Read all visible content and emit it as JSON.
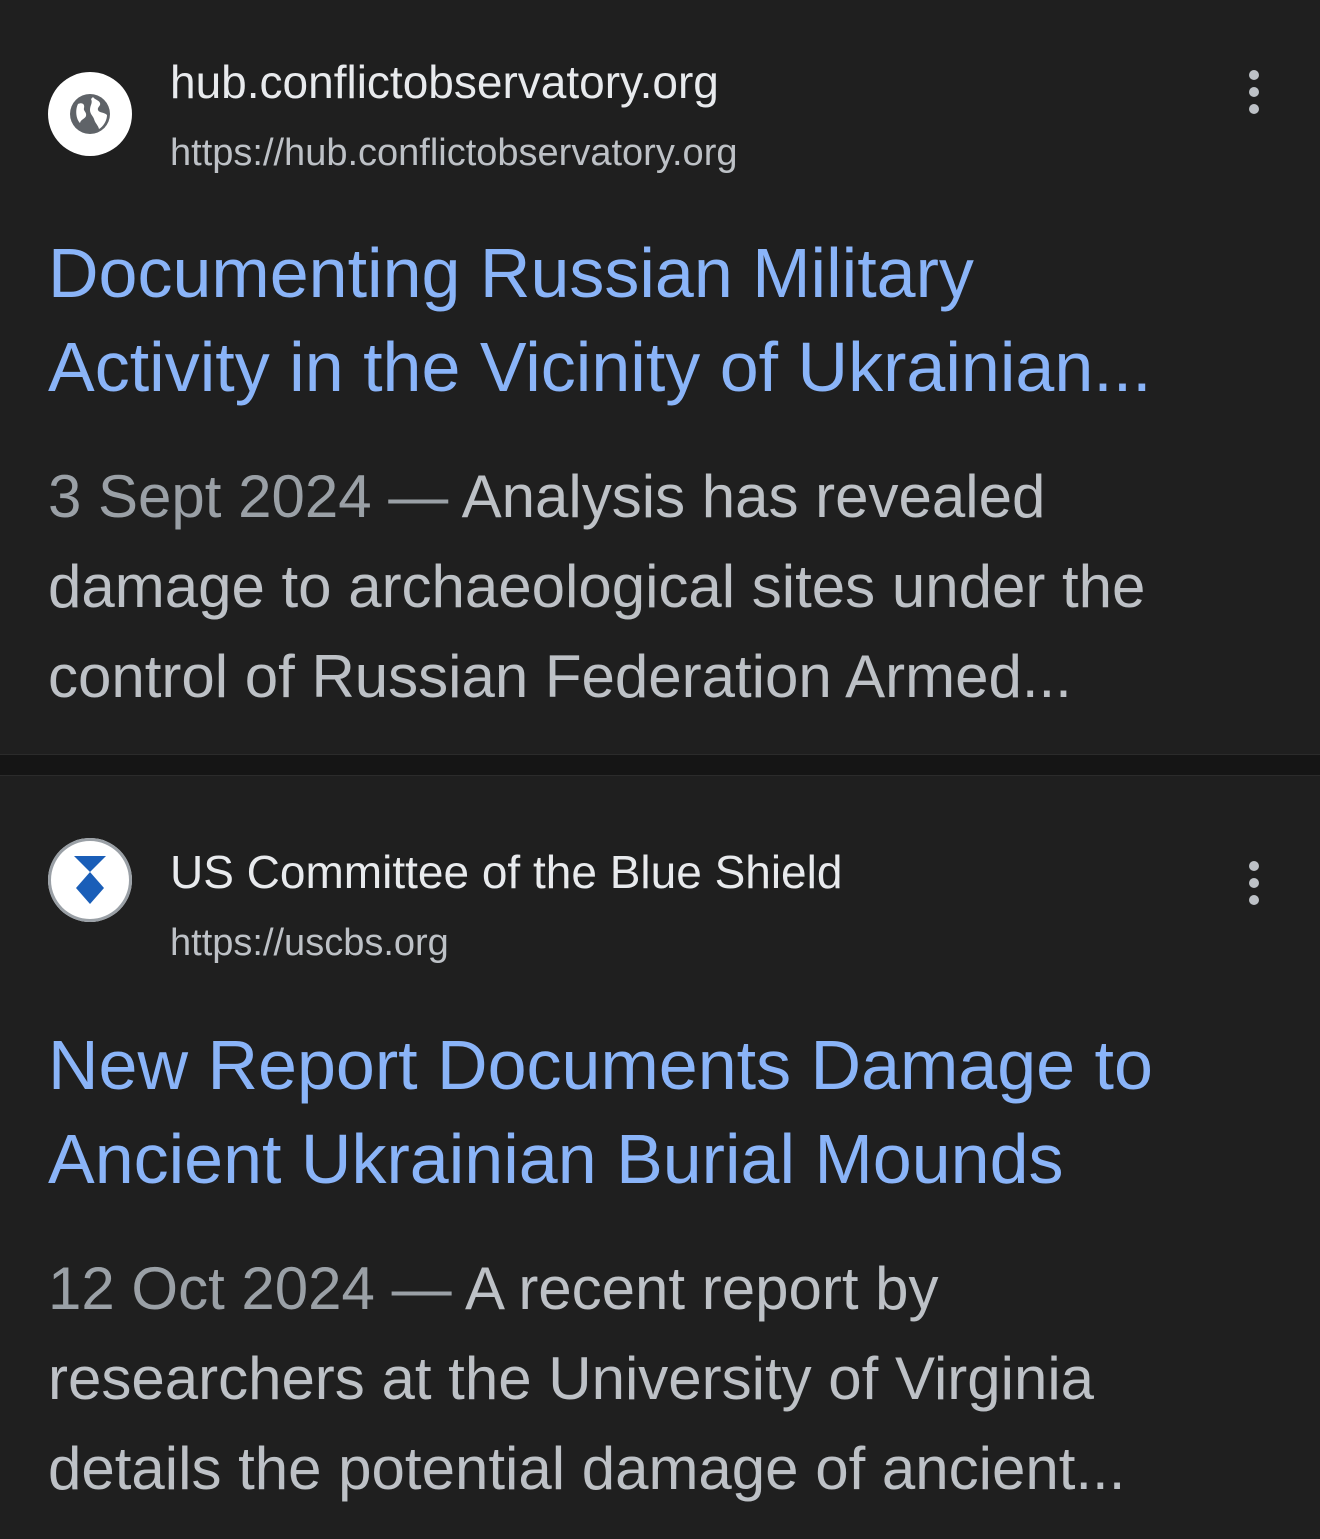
{
  "results": [
    {
      "site_name": "hub.conflictobservatory.org",
      "url": "https://hub.conflictobservatory.org",
      "favicon": "globe-icon",
      "title_lines": [
        "Documenting Russian Military",
        "Activity in the Vicinity of Ukrainian..."
      ],
      "date": "3 Sept 2024",
      "dash": "—",
      "snippet_lines": [
        "Analysis has revealed",
        "damage to archaeological sites under the",
        "control of Russian Federation Armed..."
      ]
    },
    {
      "site_name": "US Committee of the Blue Shield",
      "url": "https://uscbs.org",
      "favicon": "blue-shield-logo",
      "title_lines": [
        "New Report Documents Damage to",
        "Ancient Ukrainian Burial Mounds"
      ],
      "date": "12 Oct 2024",
      "dash": "—",
      "snippet_lines": [
        "A recent report by",
        "researchers at the University of Virginia",
        "details the potential damage of ancient..."
      ]
    }
  ],
  "colors": {
    "background": "#1f1f1f",
    "title_link": "#8ab4f8",
    "snippet_text": "#bdc1c6",
    "blue_shield": "#1a5eb8"
  }
}
